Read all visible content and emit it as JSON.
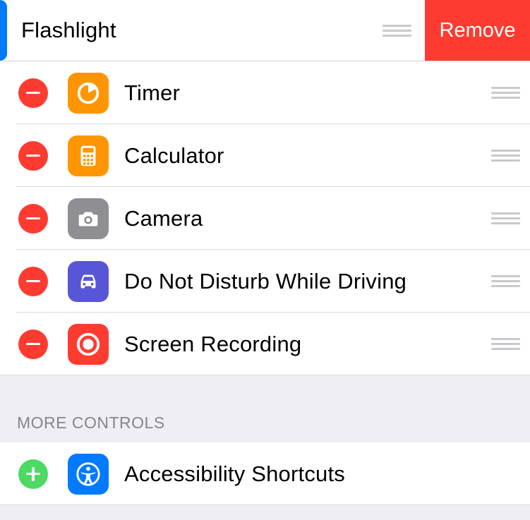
{
  "swiped_item": {
    "label": "Flashlight",
    "remove_label": "Remove"
  },
  "included": [
    {
      "label": "Timer",
      "icon": "timer-icon",
      "bg": "bg-orange"
    },
    {
      "label": "Calculator",
      "icon": "calculator-icon",
      "bg": "bg-orange"
    },
    {
      "label": "Camera",
      "icon": "camera-icon",
      "bg": "bg-gray"
    },
    {
      "label": "Do Not Disturb While Driving",
      "icon": "car-icon",
      "bg": "bg-indigo"
    },
    {
      "label": "Screen Recording",
      "icon": "record-icon",
      "bg": "bg-red"
    }
  ],
  "more_section": {
    "header": "MORE CONTROLS",
    "items": [
      {
        "label": "Accessibility Shortcuts",
        "icon": "accessibility-icon",
        "bg": "bg-blue"
      }
    ]
  }
}
